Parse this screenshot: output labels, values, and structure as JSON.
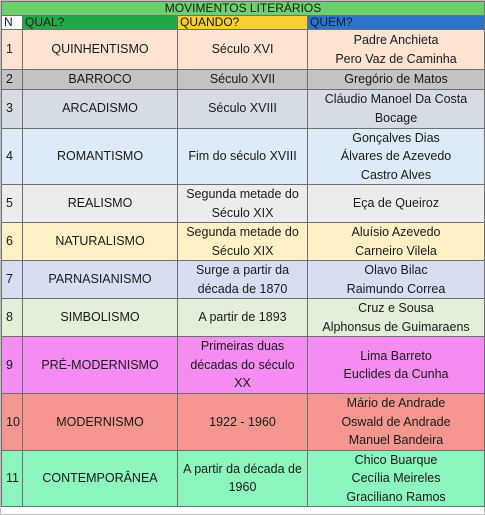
{
  "title": "MOVIMENTOS LITERÁRIOS",
  "headers": {
    "n": "N",
    "qual": "QUAL?",
    "quando": "QUANDO?",
    "quem": "QUEM?"
  },
  "colors": {
    "title_bg": "#6cd06c",
    "qual_header": "#22a846",
    "quando_header": "#f7ce35",
    "quem_header": "#2c74c6"
  },
  "rows": [
    {
      "n": "1",
      "qual": "QUINHENTISMO",
      "quando": [
        "Século XVI"
      ],
      "quem": [
        "Padre Anchieta",
        "Pero Vaz de Caminha"
      ],
      "color": "#fde4d2"
    },
    {
      "n": "2",
      "qual": "BARROCO",
      "quando": [
        "Século XVII"
      ],
      "quem": [
        "Gregório de Matos"
      ],
      "color": "#c3c3c3"
    },
    {
      "n": "3",
      "qual": "ARCADISMO",
      "quando": [
        "Século XVIII"
      ],
      "quem": [
        "Cláudio Manoel Da Costa",
        "Bocage"
      ],
      "color": "#d6dce4"
    },
    {
      "n": "4",
      "qual": "ROMANTISMO",
      "quando": [
        "Fim do século XVIII"
      ],
      "quem": [
        "Gonçalves Dias",
        "Álvares de Azevedo",
        "Castro Alves"
      ],
      "color": "#dcebf7"
    },
    {
      "n": "5",
      "qual": "REALISMO",
      "quando": [
        "Segunda metade do",
        "Século XIX"
      ],
      "quem": [
        "Eça de Queiroz"
      ],
      "color": "#ececec"
    },
    {
      "n": "6",
      "qual": "NATURALISMO",
      "quando": [
        "Segunda metade do",
        "Século XIX"
      ],
      "quem": [
        "Aluísio Azevedo",
        "Carneiro Vilela"
      ],
      "color": "#fff0c6"
    },
    {
      "n": "7",
      "qual": "PARNASIANISMO",
      "quando": [
        "Surge a partir da",
        "década de 1870"
      ],
      "quem": [
        "Olavo Bilac",
        "Raimundo Correa"
      ],
      "color": "#d8def2"
    },
    {
      "n": "8",
      "qual": "SIMBOLISMO",
      "quando": [
        "A partir de 1893"
      ],
      "quem": [
        "Cruz e Sousa",
        "Alphonsus de Guimaraens"
      ],
      "color": "#e2efd9"
    },
    {
      "n": "9",
      "qual": "PRÉ-MODERNISMO",
      "quando": [
        "Primeiras duas",
        "décadas do século",
        "XX"
      ],
      "quem": [
        "Lima Barreto",
        "Euclides da Cunha"
      ],
      "color": "#f58cf1"
    },
    {
      "n": "10",
      "qual": "MODERNISMO",
      "quando": [
        "1922 - 1960"
      ],
      "quem": [
        "Mário de Andrade",
        "Oswald de Andrade",
        "Manuel Bandeira"
      ],
      "color": "#f4968f"
    },
    {
      "n": "11",
      "qual": "CONTEMPORÂNEA",
      "quando": [
        "A partir da década de",
        "1960"
      ],
      "quem": [
        "Chico Buarque",
        "Cecília Meireles",
        "Graciliano Ramos"
      ],
      "color": "#8cf5bd"
    }
  ]
}
